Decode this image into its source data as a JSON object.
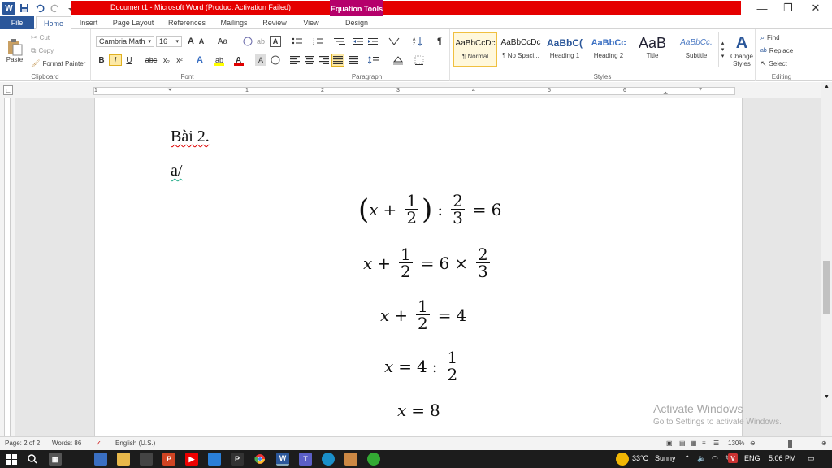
{
  "window": {
    "title": "Document1 - Microsoft Word (Product Activation Failed)",
    "contextual_tab_group": "Equation Tools",
    "minimize": "—",
    "restore": "❐",
    "close": "✕"
  },
  "tabs": [
    {
      "label": "File"
    },
    {
      "label": "Home"
    },
    {
      "label": "Insert"
    },
    {
      "label": "Page Layout"
    },
    {
      "label": "References"
    },
    {
      "label": "Mailings"
    },
    {
      "label": "Review"
    },
    {
      "label": "View"
    },
    {
      "label": "Design"
    }
  ],
  "ribbon": {
    "clipboard": {
      "paste": "Paste",
      "cut": "Cut",
      "copy": "Copy",
      "format_painter": "Format Painter",
      "label": "Clipboard"
    },
    "font": {
      "font_name": "Cambria Math",
      "font_size": "16",
      "bold": "B",
      "italic": "I",
      "underline": "U",
      "strike": "abc",
      "subscript": "x₂",
      "superscript": "x²",
      "grow": "A",
      "shrink": "A",
      "case": "Aa",
      "label": "Font"
    },
    "paragraph": {
      "show_marks": "¶",
      "label": "Paragraph"
    },
    "styles": {
      "items": [
        {
          "preview": "AaBbCcDc",
          "name": "¶ Normal"
        },
        {
          "preview": "AaBbCcDc",
          "name": "¶ No Spaci..."
        },
        {
          "preview": "AaBbC(",
          "name": "Heading 1"
        },
        {
          "preview": "AaBbCc",
          "name": "Heading 2"
        },
        {
          "preview": "AaB",
          "name": "Title"
        },
        {
          "preview": "AaBbCc.",
          "name": "Subtitle"
        }
      ],
      "change_styles": "Change Styles",
      "label": "Styles"
    },
    "editing": {
      "find": "Find",
      "replace": "Replace",
      "select": "Select",
      "label": "Editing"
    }
  },
  "ruler": {
    "numbers": [
      "1",
      "1",
      "2",
      "3",
      "4",
      "5",
      "6",
      "7"
    ]
  },
  "document": {
    "heading": "Bài 2.",
    "part": "a/",
    "equations": [
      {
        "lhs_var": "x",
        "plus": "+",
        "f1_num": "1",
        "f1_den": "2",
        "colon": ":",
        "f2_num": "2",
        "f2_den": "3",
        "eq": "=",
        "rhs": "6"
      },
      {
        "lhs_var": "x",
        "plus": "+",
        "f1_num": "1",
        "f1_den": "2",
        "eq": "=",
        "rhs": "6",
        "times": "×",
        "f2_num": "2",
        "f2_den": "3"
      },
      {
        "lhs_var": "x",
        "plus": "+",
        "f1_num": "1",
        "f1_den": "2",
        "eq": "=",
        "rhs": "4"
      },
      {
        "lhs_var": "x",
        "eq": "=",
        "rhs": "4",
        "colon": ":",
        "f1_num": "1",
        "f1_den": "2"
      },
      {
        "lhs_var": "x",
        "eq": "=",
        "rhs": "8"
      }
    ]
  },
  "watermark": {
    "line1": "Activate Windows",
    "line2": "Go to Settings to activate Windows."
  },
  "statusbar": {
    "page": "Page: 2 of 2",
    "words": "Words: 86",
    "language": "English (U.S.)",
    "zoom": "130%"
  },
  "taskbar": {
    "temperature": "33°C",
    "weather": "Sunny",
    "lang": "ENG",
    "time": "5:06 PM"
  }
}
